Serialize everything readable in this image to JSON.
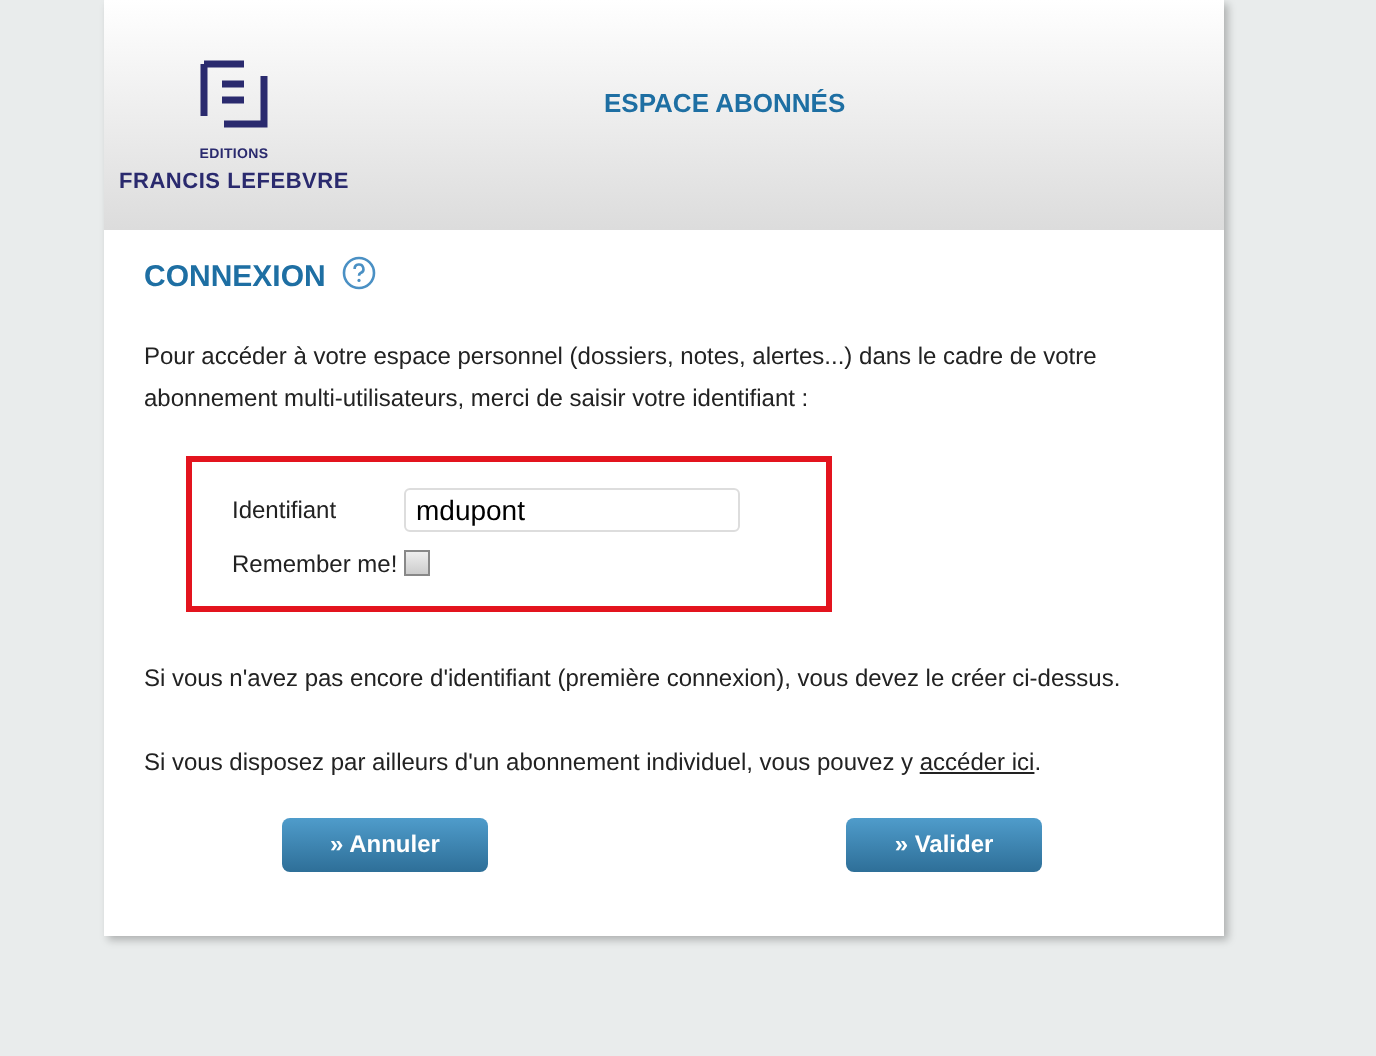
{
  "header": {
    "logo_small": "EDITIONS",
    "logo_large": "FRANCIS LEFEBVRE",
    "title": "ESPACE ABONNÉS"
  },
  "heading": "CONNEXION",
  "intro": "Pour accéder à votre espace personnel (dossiers, notes, alertes...) dans le cadre de votre abonnement multi-utilisateurs, merci de saisir votre identifiant :",
  "form": {
    "identifiant_label": "Identifiant",
    "identifiant_value": "mdupont",
    "remember_label": "Remember me!",
    "remember_checked": false
  },
  "note": "Si vous n'avez pas encore d'identifiant (première connexion), vous devez le créer ci-dessus.",
  "individual": {
    "before": "Si vous disposez par ailleurs d'un abonnement individuel, vous pouvez y ",
    "link": "accéder ici",
    "after": "."
  },
  "buttons": [
    "» Annuler",
    "» Valider"
  ]
}
